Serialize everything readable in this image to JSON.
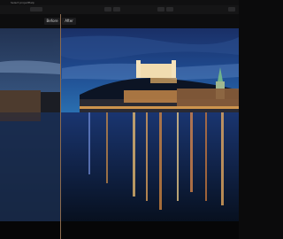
{
  "menu": {
    "items": [
      "",
      "Select project",
      "Help"
    ]
  },
  "toolbar": {
    "zoom_value": "",
    "center_icons": [
      "compare-icon",
      "layout-icon"
    ],
    "right_icons": [
      "undo-icon",
      "redo-icon",
      "settings-icon"
    ]
  },
  "compare": {
    "before_label": "Before",
    "after_label": "After"
  },
  "photo": {
    "description_icon": "castle-river-night-photo",
    "accent": "#d08a3a",
    "sky_color": "#1b3f7a",
    "water_color": "#0f2142"
  }
}
